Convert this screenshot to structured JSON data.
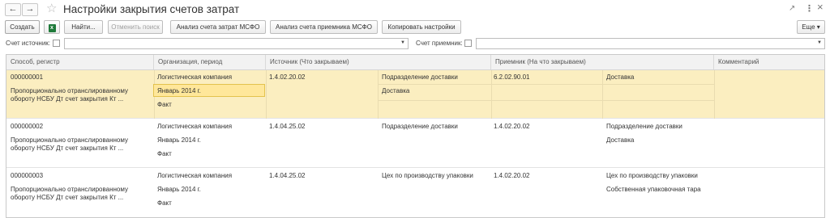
{
  "window": {
    "title": "Настройки закрытия счетов затрат",
    "back_glyph": "←",
    "forward_glyph": "→",
    "star_glyph": "☆",
    "link_glyph": "🔗",
    "menu_glyph": "⋮",
    "close_glyph": "×"
  },
  "toolbar": {
    "create": "Создать",
    "find": "Найти...",
    "cancel_search": "Отменить поиск",
    "analysis_cost": "Анализ счета затрат МСФО",
    "analysis_receiver": "Анализ счета приемника МСФО",
    "copy_settings": "Копировать настройки",
    "more": "Еще ▾",
    "excel_icon": "excel-export-icon",
    "more_menu_icon": "chevron-down-icon"
  },
  "filters": {
    "source_label": "Счет источник:",
    "source_value": "",
    "receiver_label": "Счет приемник:",
    "receiver_value": ""
  },
  "table": {
    "headers": {
      "method": "Способ, регистр",
      "org": "Организация, период",
      "source": "Источник (Что закрываем)",
      "receiver": "Приемник (На что закрываем)",
      "comment": "Комментарий"
    },
    "rows": [
      {
        "code": "000000001",
        "method": "Пропорционально отранслированному обороту НСБУ Дт счет закрытия Кт ...",
        "org": "Логистическая компания",
        "period": "Январь 2014 г.",
        "fact": "Факт",
        "src_acc": "1.4.02.20.02",
        "src_sub1": "Подразделение доставки",
        "src_sub2": "Доставка",
        "rcv_acc": "6.2.02.90.01",
        "rcv_sub1": "Доставка",
        "rcv_sub2": "",
        "comment": ""
      },
      {
        "code": "000000002",
        "method": "Пропорционально отранслированному обороту НСБУ Дт счет закрытия Кт ...",
        "org": "Логистическая компания",
        "period": "Январь 2014 г.",
        "fact": "Факт",
        "src_acc": "1.4.04.25.02",
        "src_sub1": "Подразделение доставки",
        "src_sub2": "",
        "rcv_acc": "1.4.02.20.02",
        "rcv_sub1": "Подразделение доставки",
        "rcv_sub2": "Доставка",
        "comment": ""
      },
      {
        "code": "000000003",
        "method": "Пропорционально отранслированному обороту НСБУ Дт счет закрытия Кт ...",
        "org": "Логистическая компания",
        "period": "Январь 2014 г.",
        "fact": "Факт",
        "src_acc": "1.4.04.25.02",
        "src_sub1": "Цех по производству упаковки",
        "src_sub2": "",
        "rcv_acc": "1.4.02.20.02",
        "rcv_sub1": "Цех по производству упаковки",
        "rcv_sub2": "Собственная упаковочная тара",
        "comment": ""
      }
    ]
  },
  "colors": {
    "selected_row": "#fbeec0",
    "selected_cell": "#ffe79a",
    "header_bg": "#f2f2f2",
    "excel_green": "#1f7a3a"
  }
}
